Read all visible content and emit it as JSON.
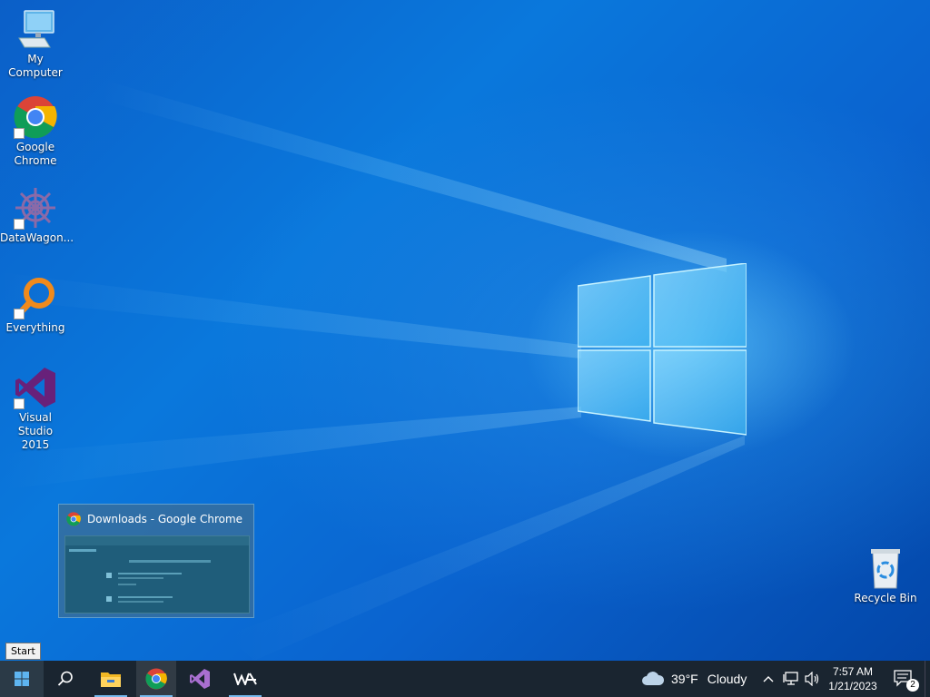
{
  "desktop": {
    "icons": [
      {
        "label": "My Computer",
        "icon": "computer-icon"
      },
      {
        "label": "Google Chrome",
        "icon": "chrome-icon"
      },
      {
        "label": "DataWagon...",
        "icon": "datawagon-icon"
      },
      {
        "label": "Everything",
        "icon": "everything-icon"
      },
      {
        "label": "Visual Studio 2015",
        "icon": "visual-studio-icon"
      },
      {
        "label": "Recycle Bin",
        "icon": "recycle-bin-icon"
      }
    ]
  },
  "preview": {
    "title": "Downloads - Google Chrome"
  },
  "tooltip": {
    "text": "Start"
  },
  "taskbar": {
    "weather_temp": "39°F",
    "weather_desc": "Cloudy",
    "time": "7:57 AM",
    "date": "1/21/2023",
    "notification_count": "2"
  }
}
